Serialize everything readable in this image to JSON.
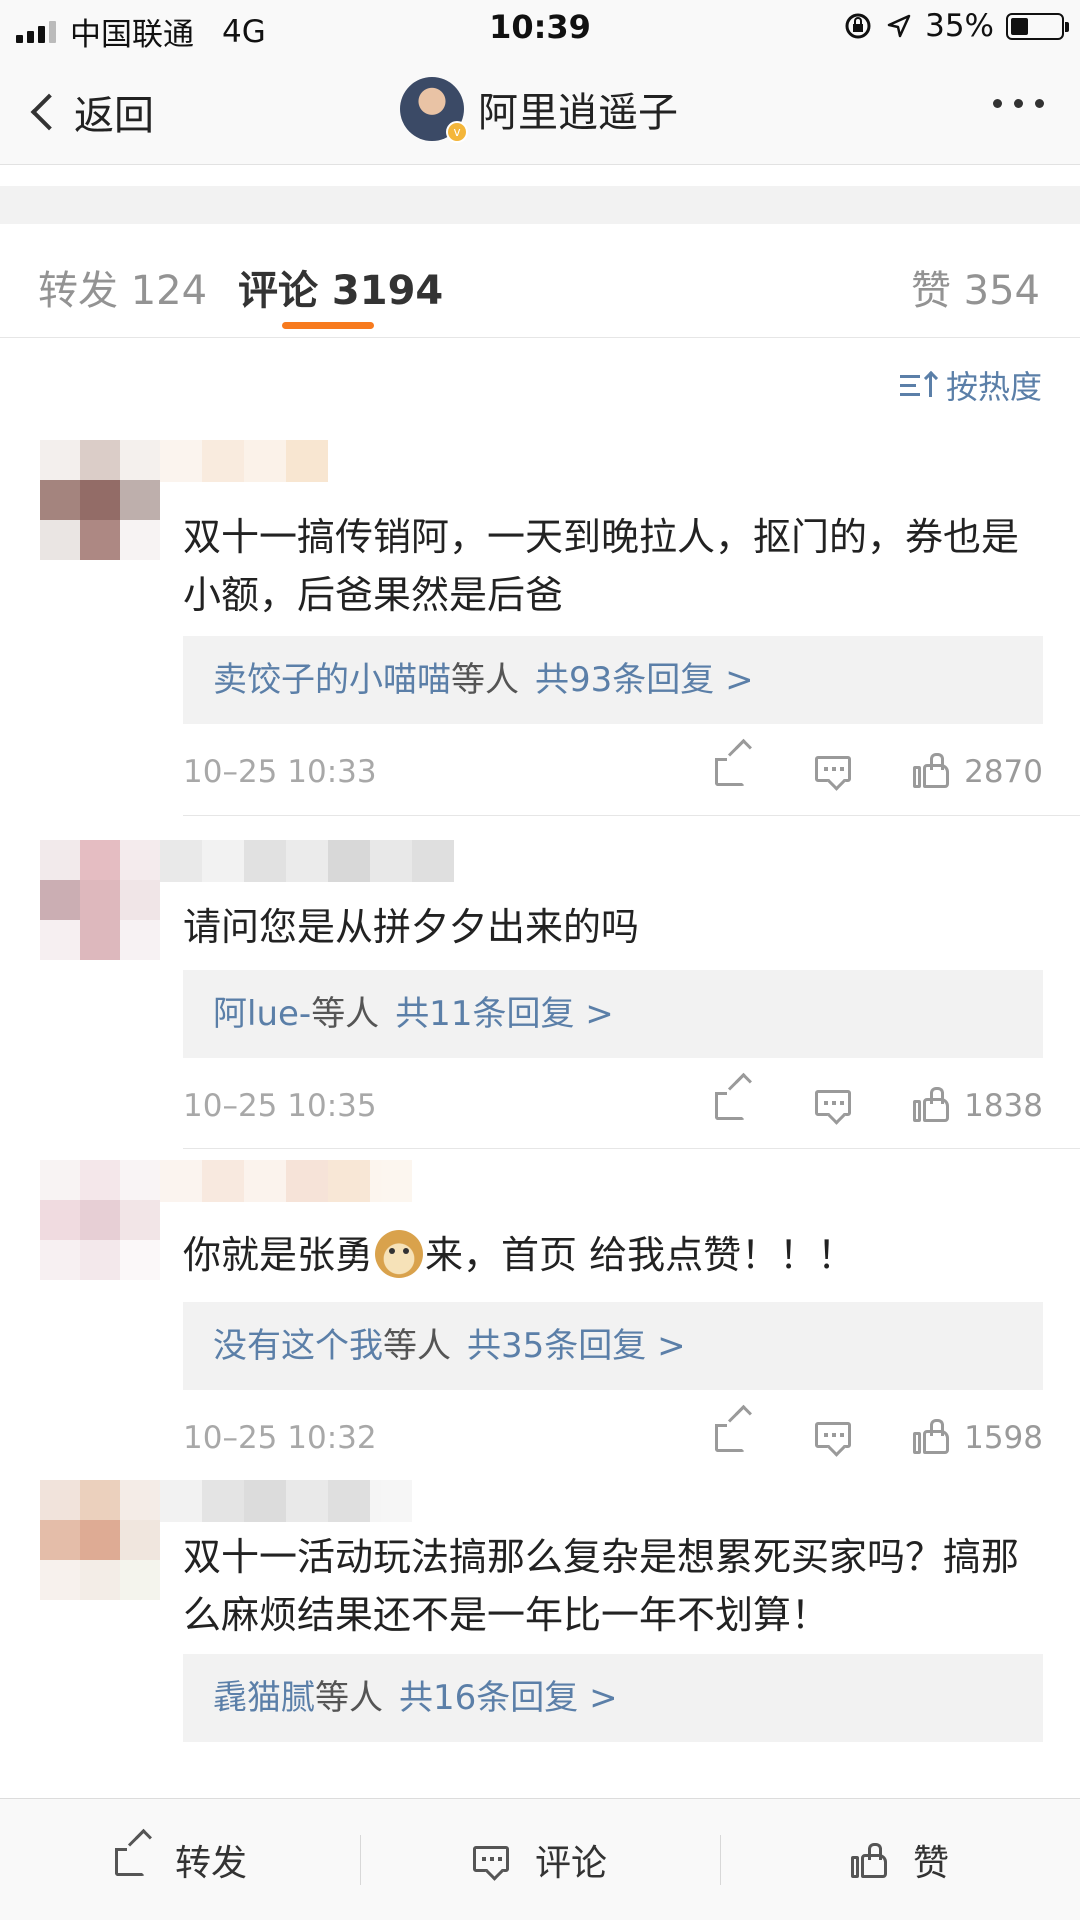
{
  "status_bar": {
    "carrier": "中国联通",
    "network": "4G",
    "time": "10:39",
    "battery": "35%",
    "battery_level": 0.35
  },
  "nav": {
    "back_label": "返回",
    "title": "阿里逍遥子",
    "verified_badge": "v"
  },
  "tabs": {
    "repost": "转发 124",
    "comments": "评论 3194",
    "likes": "赞 354",
    "active": "comments",
    "indicator_color": "#f77a1e"
  },
  "sort": {
    "label": "按热度"
  },
  "comments": [
    {
      "text": "双十一搞传销阿，一天到晚拉人，抠门的，券也是小额，后爸果然是后爸",
      "reply_users": "卖饺子的小喵喵",
      "reply_suffix": "等人",
      "reply_count": "共93条回复 >",
      "timestamp": "10–25 10:33",
      "likes": "2870"
    },
    {
      "text": "请问您是从拼夕夕出来的吗",
      "reply_users": "阿lue-",
      "reply_suffix": "等人",
      "reply_count": "共11条回复 >",
      "timestamp": "10–25 10:35",
      "likes": "1838"
    },
    {
      "text_before": "你就是张勇",
      "emoji": "doge-emoji",
      "text_after": "来，首页 给我点赞！！！",
      "reply_users": "没有这个我",
      "reply_suffix": "等人",
      "reply_count": "共35条回复 >",
      "timestamp": "10–25 10:32",
      "likes": "1598"
    },
    {
      "text": "双十一活动玩法搞那么复杂是想累死买家吗？搞那么麻烦结果还不是一年比一年不划算！",
      "reply_users": "毳猫腻",
      "reply_suffix": "等人",
      "reply_count": "共16条回复 >"
    }
  ],
  "bottom_bar": {
    "repost": "转发",
    "comment": "评论",
    "like": "赞"
  },
  "colors": {
    "link": "#5b7fa8",
    "accent": "#f77a1e",
    "meta": "#a8a8a8"
  },
  "icons": [
    "signal-icon",
    "location-lock-icon",
    "location-arrow-icon",
    "battery-icon",
    "back-chevron-icon",
    "more-icon",
    "sort-icon",
    "share-icon",
    "comment-icon",
    "like-icon"
  ]
}
